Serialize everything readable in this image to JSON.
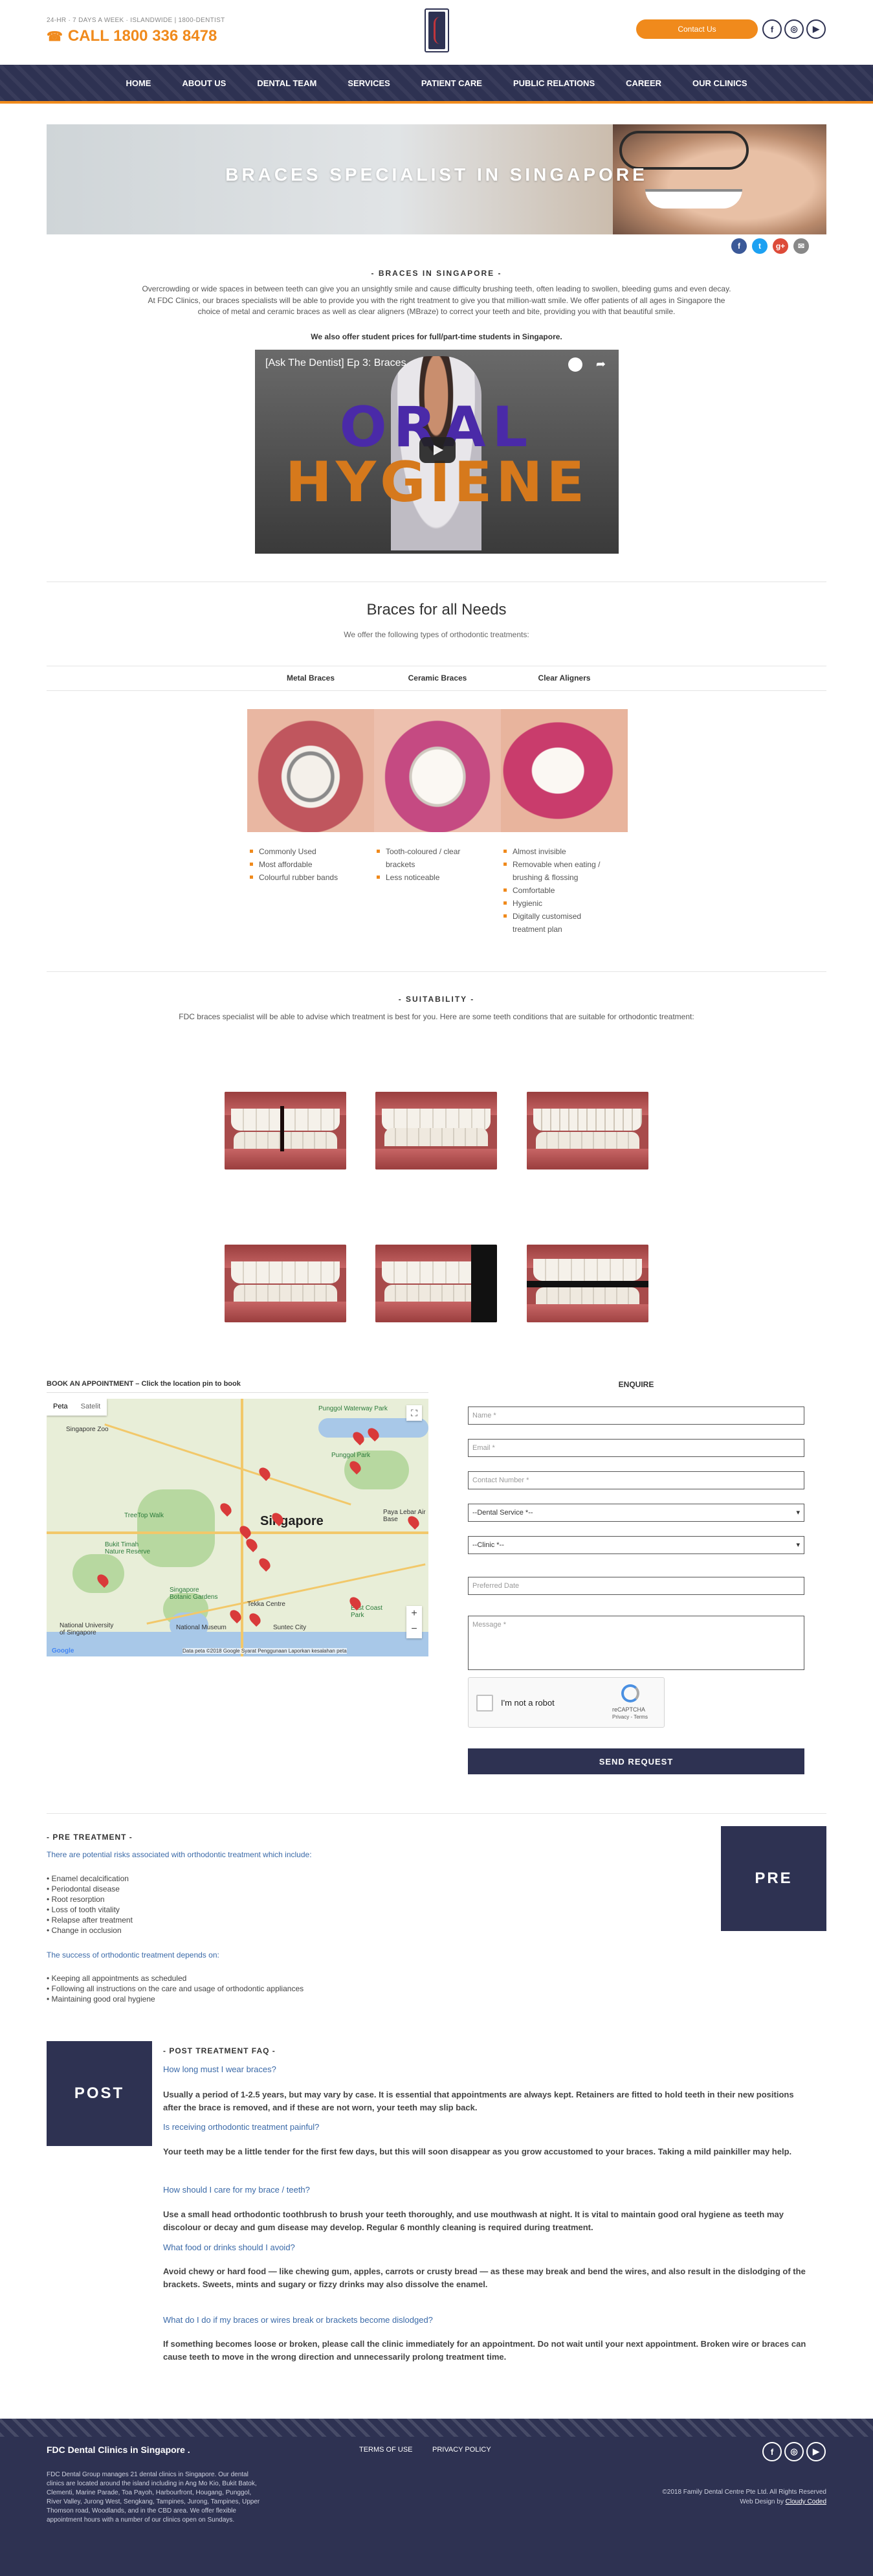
{
  "header": {
    "hours": "24-HR · 7 DAYS A WEEK · ISLANDWIDE | 1800-DENTIST",
    "phone": "CALL 1800 336 8478",
    "contact_label": "Contact Us",
    "social_icons": [
      "facebook-icon",
      "instagram-icon",
      "youtube-icon"
    ]
  },
  "nav": {
    "items": [
      "HOME",
      "ABOUT US",
      "DENTAL TEAM",
      "SERVICES",
      "PATIENT CARE",
      "PUBLIC RELATIONS",
      "CAREER",
      "OUR CLINICS"
    ]
  },
  "hero": {
    "title": "BRACES SPECIALIST IN SINGAPORE"
  },
  "share": {
    "items": [
      {
        "name": "facebook",
        "glyph": "f",
        "color": "#3b5998"
      },
      {
        "name": "twitter",
        "glyph": "t",
        "color": "#1da1f2"
      },
      {
        "name": "google-plus",
        "glyph": "g+",
        "color": "#dd4b39"
      },
      {
        "name": "email",
        "glyph": "✉",
        "color": "#888888"
      }
    ]
  },
  "intro": {
    "title": "- BRACES IN SINGAPORE -",
    "p1": "Overcrowding or wide spaces in between teeth can give you an unsightly smile and cause difficulty brushing teeth, often leading to swollen, bleeding gums and even decay.",
    "p2": "At FDC Clinics, our braces specialists will be able to provide you with the right treatment to give you that million-watt smile. We offer patients of all ages in Singapore the choice of metal and ceramic braces as well as clear aligners (MBraze) to correct your teeth and bite, providing you with that beautiful smile.",
    "student": "We also offer student prices for full/part-time students in Singapore."
  },
  "video": {
    "title": "[Ask The Dentist] Ep 3: Braces",
    "line1": "ORAL",
    "line2": "HYGIENE"
  },
  "needs": {
    "title": "Braces for all Needs",
    "subtitle": "We offer the following types of orthodontic treatments:",
    "types": [
      {
        "name": "Metal Braces",
        "points": [
          "Commonly Used",
          "Most affordable",
          "Colourful rubber bands"
        ]
      },
      {
        "name": "Ceramic Braces",
        "points": [
          "Tooth-coloured / clear brackets",
          "Less noticeable"
        ]
      },
      {
        "name": "Clear Aligners",
        "points": [
          "Almost invisible",
          "Removable when eating / brushing & flossing",
          "Comfortable",
          "Hygienic",
          "Digitally customised treatment plan"
        ]
      }
    ]
  },
  "suitability": {
    "title": "- SUITABILITY -",
    "text": "FDC braces specialist will be able to advise which treatment is best for you. Here are some teeth conditions that are suitable for orthodontic treatment:"
  },
  "booking": {
    "label": "BOOK AN APPOINTMENT – Click the location pin to book",
    "map_tab_map": "Peta",
    "map_tab_sat": "Satelit",
    "map_city": "Singapore",
    "map_footer": "Data peta ©2018 Google   Syarat Penggunaan   Laporkan kesalahan peta",
    "map_places": [
      "Singapore Zoo",
      "Punggol Waterway Park",
      "Punggol Park",
      "TreeTop Walk",
      "Bukit Timah Nature Reserve",
      "Paya Lebar Air Base",
      "Singapore Botanic Gardens",
      "Tekka Centre",
      "National Museum",
      "Suntec City",
      "East Coast Park",
      "National University of Singapore"
    ]
  },
  "enquire": {
    "title": "ENQUIRE",
    "name_ph": "Name *",
    "email_ph": "Email *",
    "contact_ph": "Contact Number *",
    "service_ph": "--Dental Service *--",
    "clinic_ph": "--Clinic *--",
    "date_ph": "Preferred Date",
    "message_ph": "Message *",
    "captcha": "I'm not a robot",
    "captcha_brand": "reCAPTCHA",
    "captcha_terms": "Privacy - Terms",
    "send": "SEND REQUEST"
  },
  "pre": {
    "title": "- PRE TREATMENT -",
    "intro": "There are potential risks associated with orthodontic treatment which include:",
    "risks": [
      "Enamel decalcification",
      "Periodontal disease",
      "Root resorption",
      "Loss of tooth vitality",
      "Relapse after treatment",
      "Change in occlusion"
    ],
    "success": "The success of orthodontic treatment depends on:",
    "factors": [
      "Keeping all appointments as scheduled",
      "Following all instructions on the care and usage of orthodontic appliances",
      "Maintaining good oral hygiene"
    ],
    "box": "PRE"
  },
  "post": {
    "title": "- POST TREATMENT FAQ -",
    "box": "POST",
    "q1": "How long must I wear braces?",
    "a1": "Usually a period of 1-2.5 years, but may vary by case. It is essential that appointments are always kept. Retainers are fitted to hold teeth in their new positions after the brace is removed, and if these are not worn, your teeth may slip back.",
    "q2": "Is receiving orthodontic treatment painful?",
    "a2": "Your teeth may be a little tender for the first few days, but this will soon disappear as you grow accustomed to your braces. Taking a mild painkiller may help.",
    "q3": "How should I care for my brace / teeth?",
    "a3": "Use a small head orthodontic toothbrush to brush your teeth thoroughly, and use mouthwash at night. It is vital to maintain good oral hygiene as teeth may discolour or decay and gum disease may develop. Regular 6 monthly cleaning is required during treatment.",
    "q4": "What food or drinks should I avoid?",
    "a4": "Avoid chewy or hard food — like chewing gum, apples, carrots or crusty bread — as these may break and bend the wires, and also result in the dislodging of the brackets. Sweets, mints and sugary or fizzy drinks may also dissolve the enamel.",
    "q5": "What do I do if my braces or wires break or brackets become dislodged?",
    "a5": "If something becomes loose or broken, please call the clinic immediately for an appointment. Do not wait until your next appointment. Broken wire or braces can cause teeth to move in the wrong direction and unnecessarily prolong treatment time."
  },
  "footer": {
    "title": "FDC Dental Clinics in Singapore .",
    "text": "FDC Dental Group manages 21 dental clinics in Singapore. Our dental clinics are located around the island including in Ang Mo Kio, Bukit Batok, Clementi, Marine Parade, Toa Payoh, Harbourfront, Hougang, Punggol, River Valley, Jurong West, Sengkang, Tampines, Jurong, Tampines, Upper Thomson road, Woodlands, and in the CBD area. We offer flexible appointment hours with a number of our clinics open on Sundays.",
    "terms": "TERMS OF USE",
    "privacy": "PRIVACY POLICY",
    "copyright": "©2018 Family Dental Centre Pte Ltd. All Rights Reserved",
    "design_prefix": "Web Design by",
    "design_link": "Cloudy Coded"
  }
}
